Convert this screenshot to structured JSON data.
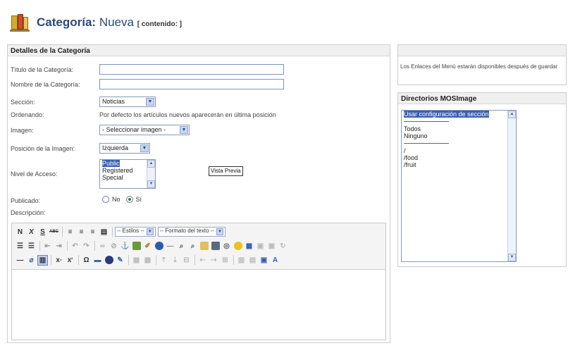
{
  "header": {
    "title": "Categoría:",
    "subtitle": "Nueva",
    "context": "[ contenido: ]"
  },
  "details": {
    "heading": "Detalles de la Categoría",
    "title_label": "Título de la Categoría:",
    "name_label": "Nombre de la Categoría:",
    "section_label": "Sección:",
    "section_value": "Noticias",
    "order_label": "Ordenando:",
    "order_note": "Por defecto los artículos nuevos aparecerán en última posición",
    "image_label": "Imagen:",
    "image_value": "- Seleccionar imagen -",
    "image_pos_label": "Posición de la Imagen:",
    "image_pos_value": "Izquierda",
    "access_label": "Nivel de Acceso:",
    "access_options": [
      "Public",
      "Registered",
      "Special"
    ],
    "preview_button": "Vista Previa",
    "published_label": "Publicado:",
    "published_no": "No",
    "published_yes": "Sí",
    "description_label": "Descripción:"
  },
  "editor": {
    "styles_select": "-- Estilos --",
    "format_select": "-- Formato del texto --",
    "bold": "N",
    "italic": "X",
    "underline": "S",
    "strike": "ABC",
    "omega": "Ω",
    "subscript": "x",
    "superscript": "x"
  },
  "right": {
    "menu_note": "Los Enlaces del Menú estarán disponibles después de guardar",
    "dir_heading": "Directorios MOSImage",
    "dir_selected": "Usar configuración de sección",
    "dir_items_a": [
      "Todos",
      "Ninguno"
    ],
    "dir_items_b": [
      "/",
      "/food",
      "/fruit"
    ]
  }
}
